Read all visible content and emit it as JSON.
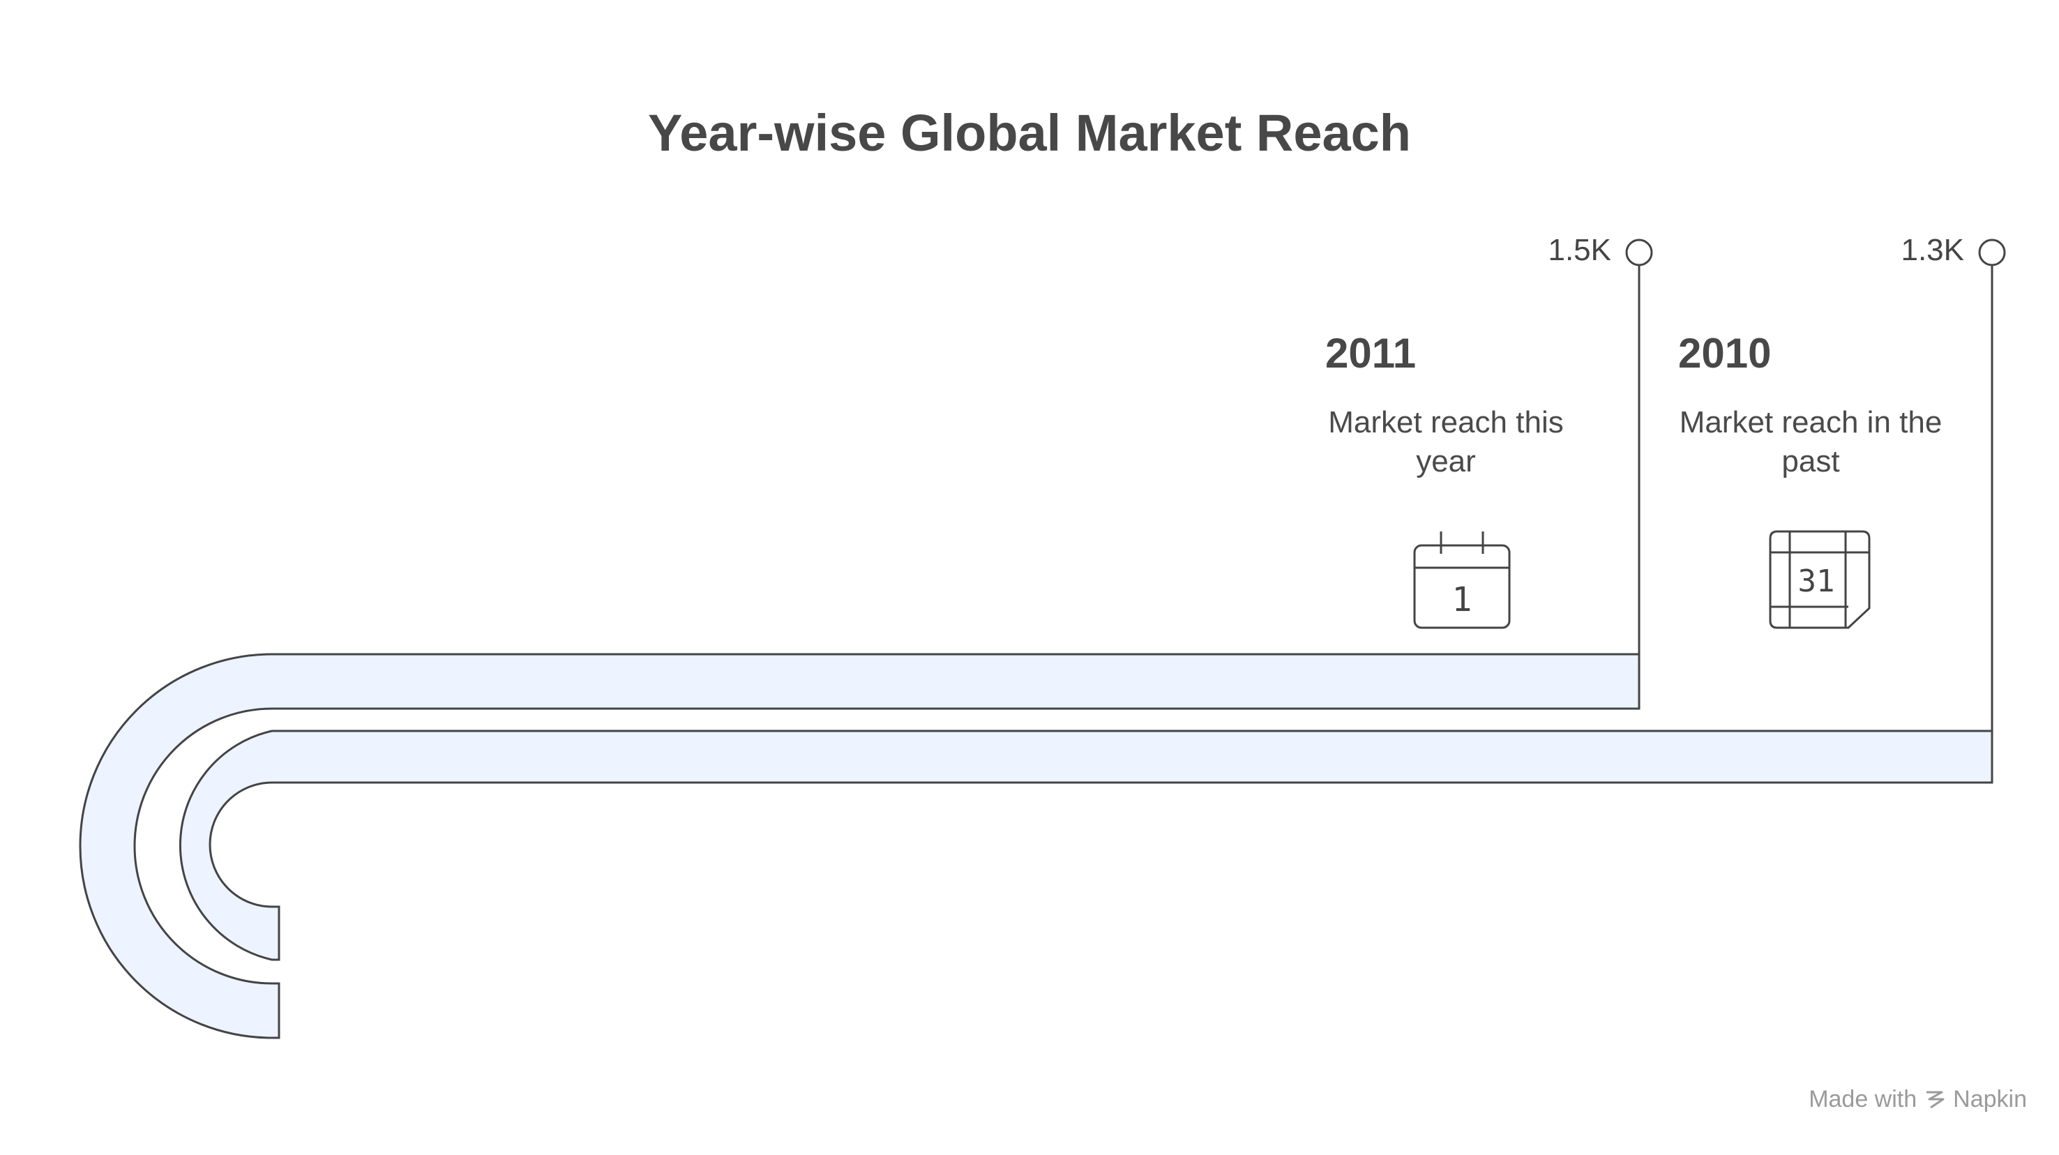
{
  "title": "Year-wise Global Market Reach",
  "milestones": [
    {
      "year": "2011",
      "value": "1.5K",
      "description_line1": "Market reach this",
      "description_line2": "year",
      "icon": "calendar-day-1-icon"
    },
    {
      "year": "2010",
      "value": "1.3K",
      "description_line1": "Market reach in the",
      "description_line2": "past",
      "icon": "calendar-31-icon"
    }
  ],
  "icon_glyphs": {
    "day1": "1",
    "day31": "31"
  },
  "footer": {
    "made_with": "Made with",
    "brand": "Napkin"
  },
  "colors": {
    "band_fill": "#EDF3FF",
    "stroke": "#444444",
    "text": "#484848",
    "footer": "#9A9A9A"
  }
}
